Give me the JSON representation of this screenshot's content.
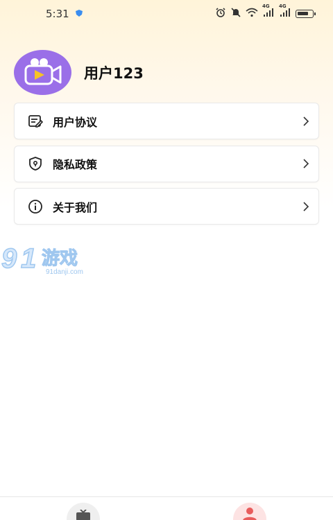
{
  "status_bar": {
    "time": "5:31",
    "signal_1_label": "4G",
    "signal_2_label": "4G"
  },
  "profile": {
    "username": "用户123",
    "avatar_icon": "video-camera-icon"
  },
  "menu": {
    "items": [
      {
        "label": "用户协议",
        "icon": "agreement-icon"
      },
      {
        "label": "隐私政策",
        "icon": "privacy-shield-icon"
      },
      {
        "label": "关于我们",
        "icon": "info-icon"
      }
    ]
  },
  "watermark": {
    "logo_text": "91游戏",
    "site": "91danji.com"
  },
  "bottom_nav": {
    "items": [
      {
        "icon": "video-tab-icon"
      },
      {
        "icon": "profile-tab-icon"
      }
    ]
  },
  "colors": {
    "avatar_bg": "#9a6fe8",
    "play_yellow": "#f7c325",
    "profile_tab": "#e85c5c"
  }
}
